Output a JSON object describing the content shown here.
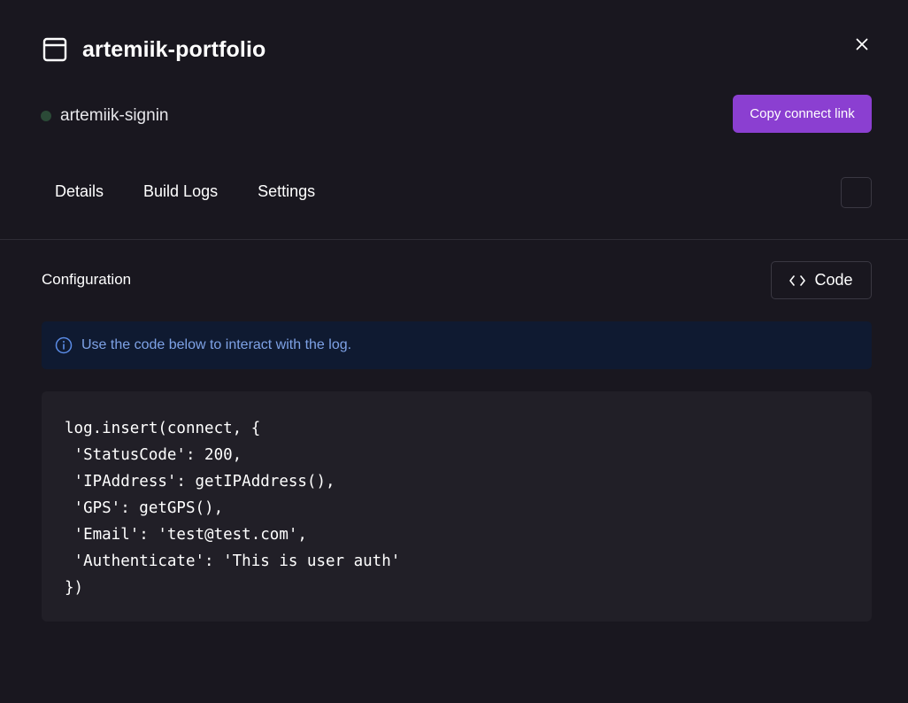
{
  "header": {
    "title": "artemiik-portfolio",
    "icon": "window-icon"
  },
  "status": {
    "label": "artemiik-signin",
    "dot_color": "#2b4a37"
  },
  "actions": {
    "copy_connect_link": "Copy connect link",
    "copy_color": "#8b3fd1"
  },
  "tabs": [
    {
      "label": "Details"
    },
    {
      "label": "Build Logs"
    },
    {
      "label": "Settings"
    }
  ],
  "configuration": {
    "title": "Configuration",
    "code_button": "Code",
    "info": "Use the code below to interact with the log.",
    "code_lines": [
      "log.insert(connect, {",
      " 'StatusCode': 200,",
      " 'IPAddress': getIPAddress(),",
      " 'GPS': getGPS(),",
      " 'Email': 'test@test.com',",
      " 'Authenticate': 'This is user auth'",
      "})"
    ]
  }
}
